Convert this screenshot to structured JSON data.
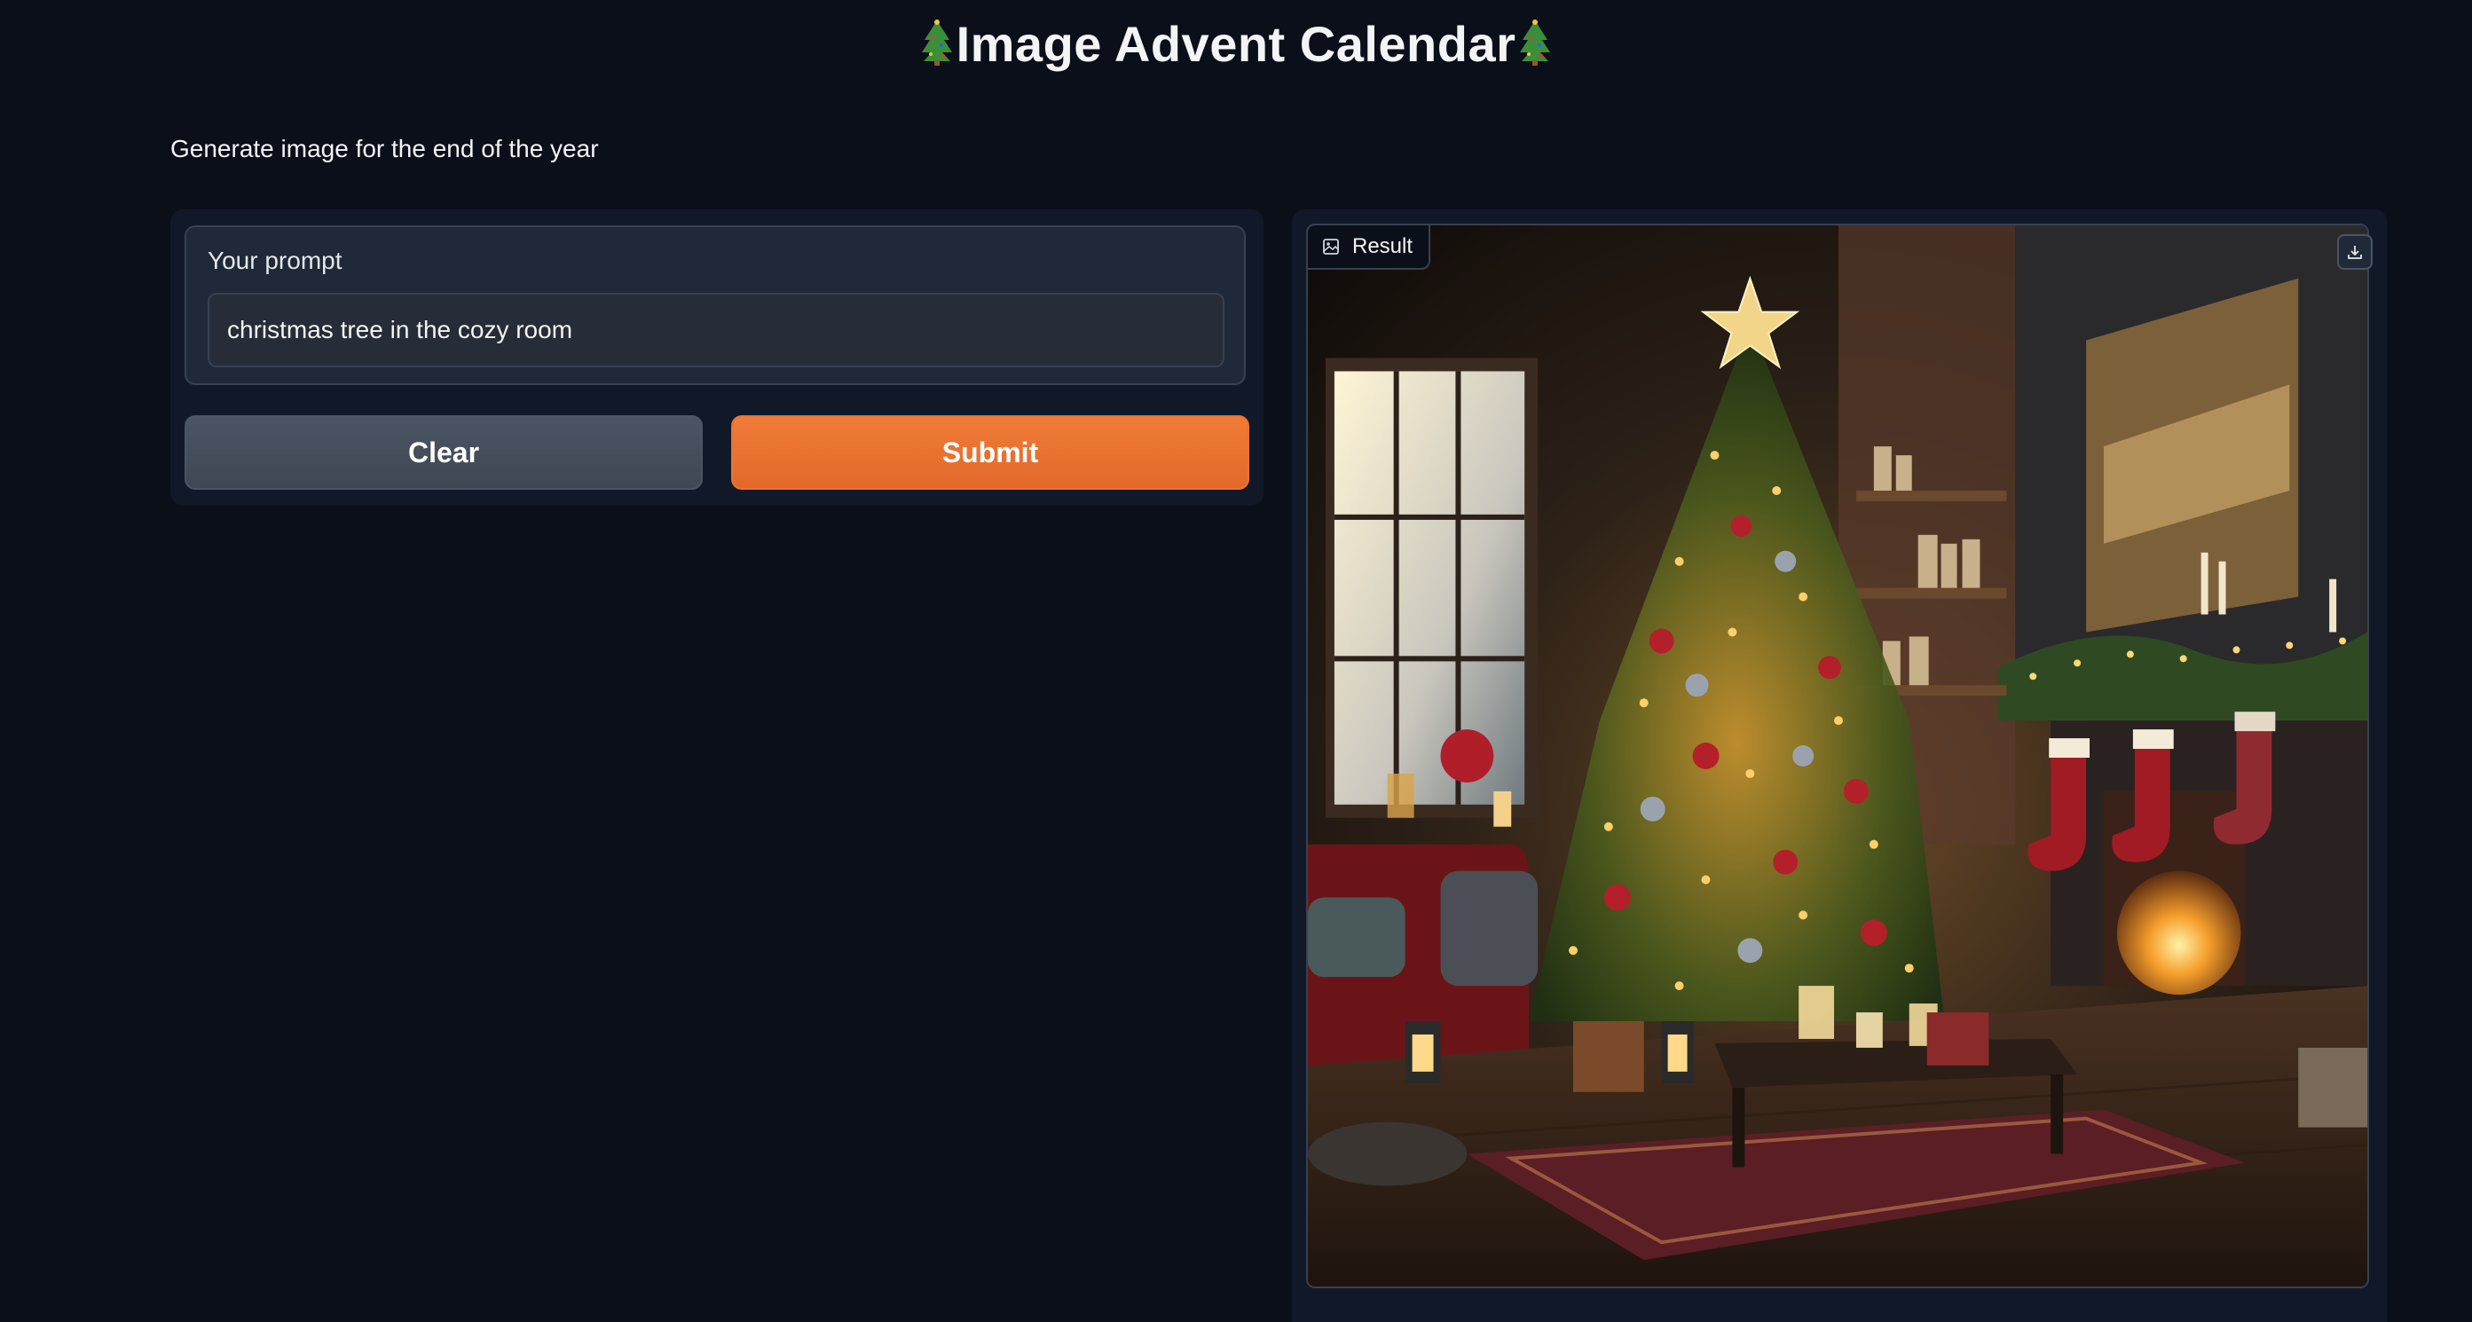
{
  "header": {
    "title": "Image Advent Calendar",
    "title_icon": "christmas-tree-icon"
  },
  "description": "Generate image for the end of the year",
  "form": {
    "prompt_label": "Your prompt",
    "prompt_value": "christmas tree in the cozy room",
    "clear_label": "Clear",
    "submit_label": "Submit"
  },
  "result": {
    "label": "Result",
    "label_icon": "image-icon",
    "download_icon": "download-icon",
    "image_description_icon": "christmas-living-room-image"
  },
  "colors": {
    "background": "#0b0f19",
    "panel": "#111827",
    "input_bg": "#1f2937",
    "clear_button": "#4b5563",
    "submit_button": "#ea7231"
  }
}
